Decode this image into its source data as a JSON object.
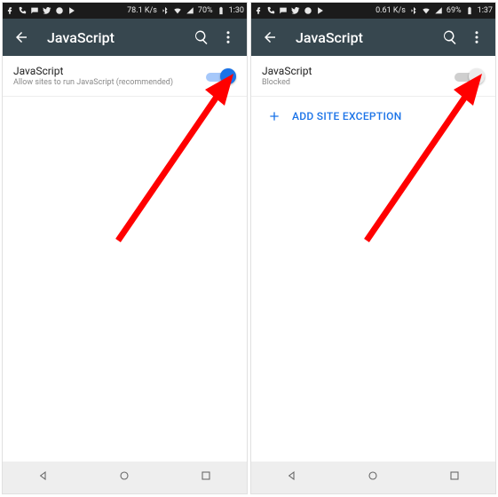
{
  "left": {
    "status": {
      "net_speed": "78.1 K/s",
      "battery": "70%",
      "time": "1:30"
    },
    "appbar": {
      "title": "JavaScript"
    },
    "setting": {
      "title": "JavaScript",
      "subtitle": "Allow sites to run JavaScript (recommended)",
      "enabled": true
    }
  },
  "right": {
    "status": {
      "net_speed": "0.61 K/s",
      "battery": "69%",
      "time": "1:37"
    },
    "appbar": {
      "title": "JavaScript"
    },
    "setting": {
      "title": "JavaScript",
      "subtitle": "Blocked",
      "enabled": false
    },
    "action": {
      "label": "ADD SITE EXCEPTION"
    }
  },
  "colors": {
    "appbar": "#37474f",
    "accent": "#1a73e8",
    "arrow": "#ff0000"
  }
}
